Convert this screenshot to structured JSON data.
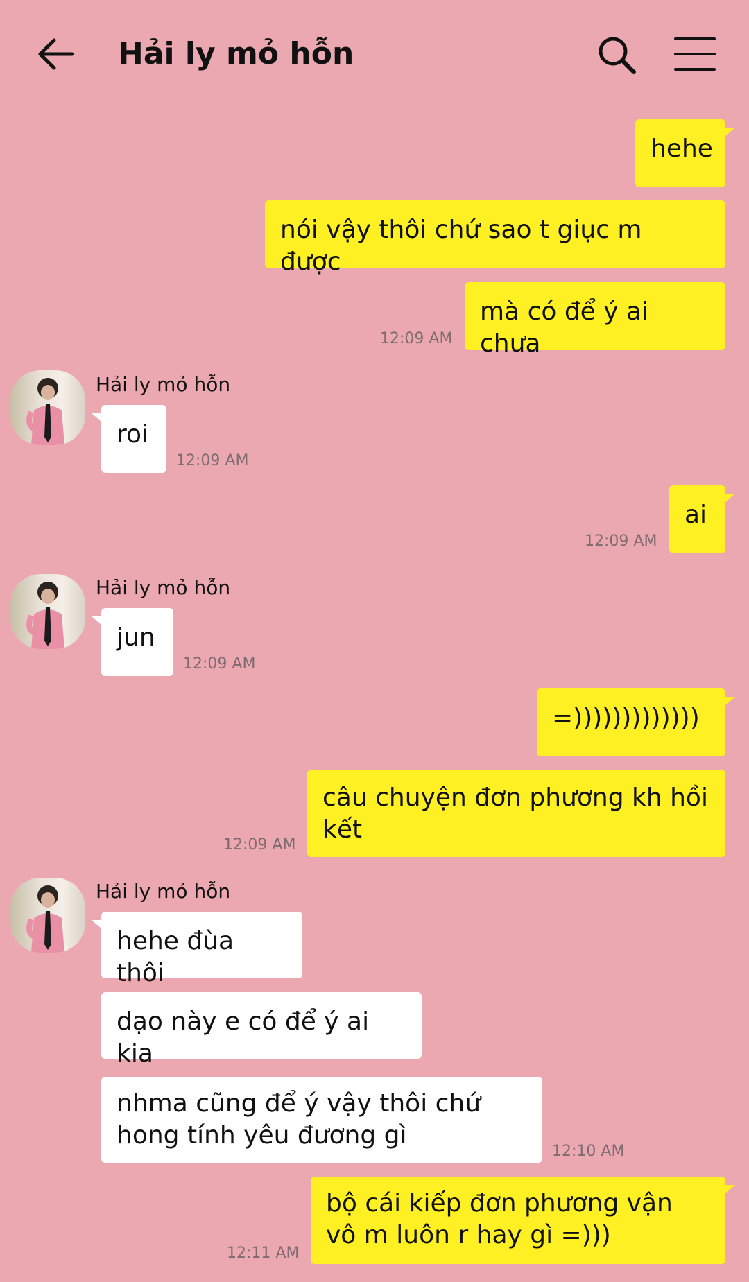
{
  "header": {
    "title": "Hải ly mỏ hỗn"
  },
  "messages": [
    {
      "text": "hehe"
    },
    {
      "text": "nói vậy thôi chứ sao t giục m được"
    },
    {
      "text": "mà có để ý ai chưa",
      "time": "12:09 AM"
    },
    {
      "sender": "Hải ly mỏ hỗn",
      "text": "roi",
      "time": "12:09 AM"
    },
    {
      "text": "ai",
      "time": "12:09 AM"
    },
    {
      "sender": "Hải ly mỏ hỗn",
      "text": "jun",
      "time": "12:09 AM"
    },
    {
      "text": "=)))))))))))))"
    },
    {
      "text": "câu chuyện đơn phương kh hồi kết",
      "time": "12:09 AM"
    },
    {
      "sender": "Hải ly mỏ hỗn",
      "text": "hehe đùa thôi"
    },
    {
      "text": "dạo này e có để ý ai kia"
    },
    {
      "text": "nhma cũng để ý vậy thôi chứ hong tính yêu đương gì",
      "time": "12:10 AM"
    },
    {
      "text": "bộ cái kiếp đơn phương vận vô m luôn r hay gì =)))",
      "time": "12:11 AM"
    }
  ]
}
